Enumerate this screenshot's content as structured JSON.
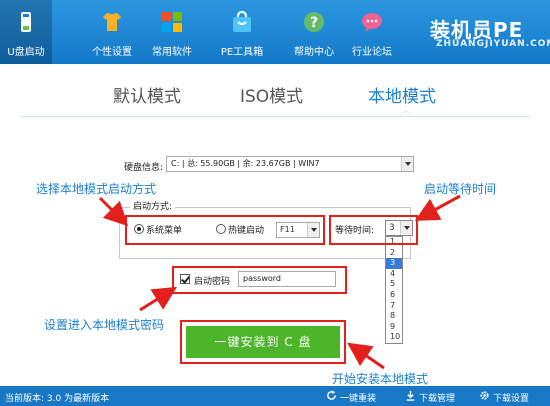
{
  "nav": {
    "tabs": [
      {
        "label": "U盘启动"
      },
      {
        "label": "个性设置"
      },
      {
        "label": "常用软件"
      },
      {
        "label": "PE工具箱"
      },
      {
        "label": "帮助中心"
      },
      {
        "label": "行业论坛"
      }
    ],
    "brand": "装机员PE",
    "brand_sub": "ZHUANGJIYUAN.COM"
  },
  "modes": {
    "default": "默认模式",
    "iso": "ISO模式",
    "local": "本地模式"
  },
  "disk": {
    "label": "硬盘信息:",
    "value": "C: | 总: 55.90GB | 余: 23.67GB | WIN7"
  },
  "boot": {
    "group_title": "启动方式:",
    "system_menu": "系统菜单",
    "hotkey_boot": "热键启动",
    "hotkey": "F11",
    "wait_label": "等待时间:",
    "wait_value": "3",
    "wait_options": [
      "1",
      "2",
      "3",
      "4",
      "5",
      "6",
      "7",
      "8",
      "9",
      "10"
    ]
  },
  "password": {
    "label": "启动密码",
    "value": "password"
  },
  "install_button": "一键安装到 C 盘",
  "annotations": {
    "choose_mode": "选择本地模式启动方式",
    "wait_time": "启动等待时间",
    "set_password": "设置进入本地模式密码",
    "start_install": "开始安装本地模式"
  },
  "status": {
    "version": "当前版本: 3.0  为最新版本",
    "reinstall": "一键重装",
    "download_mgr": "下载管理",
    "download_settings": "下载设置"
  },
  "colors": {
    "accent": "#1a7fd0",
    "highlight": "#e3201b",
    "install": "#4db52a"
  }
}
